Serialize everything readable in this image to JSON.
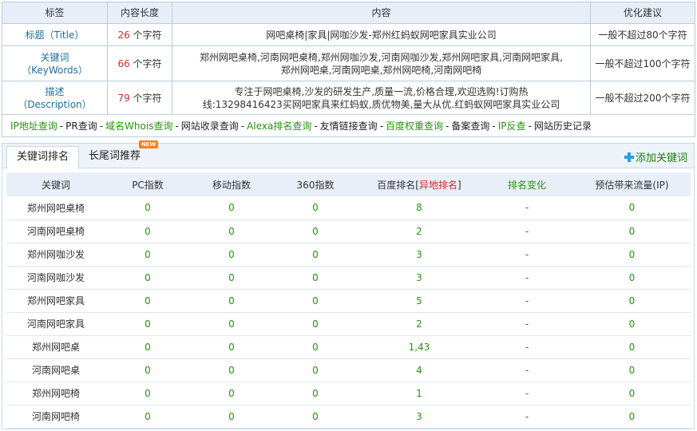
{
  "meta_table": {
    "headers": [
      "标签",
      "内容长度",
      "内容",
      "优化建议"
    ],
    "rows": [
      {
        "label": "标题（Title）",
        "length": "26",
        "unit": "个字符",
        "content": "网吧桌椅|家具|网咖沙发-郑州红蚂蚁网吧家具实业公司",
        "advice": "一般不超过80个字符"
      },
      {
        "label_line1": "关键词",
        "label_line2": "（KeyWords）",
        "length": "66",
        "unit": "个字符",
        "content_line1": "郑州网吧桌椅,河南网吧桌椅,郑州网咖沙发,河南网咖沙发,郑州网吧家具,河南网吧家具,",
        "content_line2": "郑州网吧桌,河南网吧桌,郑州网吧椅,河南网吧椅",
        "advice": "一般不超过100个字符"
      },
      {
        "label_line1": "描述",
        "label_line2": "（Description）",
        "length": "79",
        "unit": "个字符",
        "content_line1": "专注于网吧桌椅,沙发的研发生产,质量一流,价格合理,欢迎选购!订购热",
        "content_line2": "线:13298416423买网吧家具来红蚂蚁,质优物美,量大从优.红蚂蚁网吧家具实业公司",
        "advice": "一般不超过200个字符"
      }
    ],
    "links": [
      {
        "text": "IP地址查询",
        "link": true
      },
      {
        "text": "PR查询",
        "link": false
      },
      {
        "text": "域名Whois查询",
        "link": true
      },
      {
        "text": "网站收录查询",
        "link": false
      },
      {
        "text": "Alexa排名查询",
        "link": true
      },
      {
        "text": "友情链接查询",
        "link": false
      },
      {
        "text": "百度权重查询",
        "link": true
      },
      {
        "text": "备案查询",
        "link": false
      },
      {
        "text": "IP反查",
        "link": true
      },
      {
        "text": "网站历史记录",
        "link": false
      }
    ],
    "separator": "-"
  },
  "tabs": {
    "active": "关键词排名",
    "second": "长尾词推荐",
    "badge": "NEW",
    "add_keyword": "添加关键词"
  },
  "rank_table": {
    "headers": {
      "keyword": "关键词",
      "pc": "PC指数",
      "mobile": "移动指数",
      "s360": "360指数",
      "baidu_prefix": "百度排名[",
      "baidu_red": "异地排名",
      "baidu_suffix": "]",
      "change": "排名变化",
      "traffic": "预估带来流量(IP)"
    },
    "rows": [
      {
        "keyword": "郑州网吧桌椅",
        "pc": "0",
        "mobile": "0",
        "s360": "0",
        "baidu": "8",
        "change": "-",
        "traffic": "0"
      },
      {
        "keyword": "河南网吧桌椅",
        "pc": "0",
        "mobile": "0",
        "s360": "0",
        "baidu": "2",
        "change": "-",
        "traffic": "0"
      },
      {
        "keyword": "郑州网咖沙发",
        "pc": "0",
        "mobile": "0",
        "s360": "0",
        "baidu": "3",
        "change": "-",
        "traffic": "0"
      },
      {
        "keyword": "河南网咖沙发",
        "pc": "0",
        "mobile": "0",
        "s360": "0",
        "baidu": "3",
        "change": "-",
        "traffic": "0"
      },
      {
        "keyword": "郑州网吧家具",
        "pc": "0",
        "mobile": "0",
        "s360": "0",
        "baidu": "5",
        "change": "-",
        "traffic": "0"
      },
      {
        "keyword": "河南网吧家具",
        "pc": "0",
        "mobile": "0",
        "s360": "0",
        "baidu": "2",
        "change": "-",
        "traffic": "0"
      },
      {
        "keyword": "郑州网吧桌",
        "pc": "0",
        "mobile": "0",
        "s360": "0",
        "baidu": "1,43",
        "change": "-",
        "traffic": "0"
      },
      {
        "keyword": "河南网吧桌",
        "pc": "0",
        "mobile": "0",
        "s360": "0",
        "baidu": "4",
        "change": "-",
        "traffic": "0"
      },
      {
        "keyword": "郑州网吧椅",
        "pc": "0",
        "mobile": "0",
        "s360": "0",
        "baidu": "1",
        "change": "-",
        "traffic": "0"
      },
      {
        "keyword": "河南网吧椅",
        "pc": "0",
        "mobile": "0",
        "s360": "0",
        "baidu": "3",
        "change": "-",
        "traffic": "0"
      }
    ]
  }
}
